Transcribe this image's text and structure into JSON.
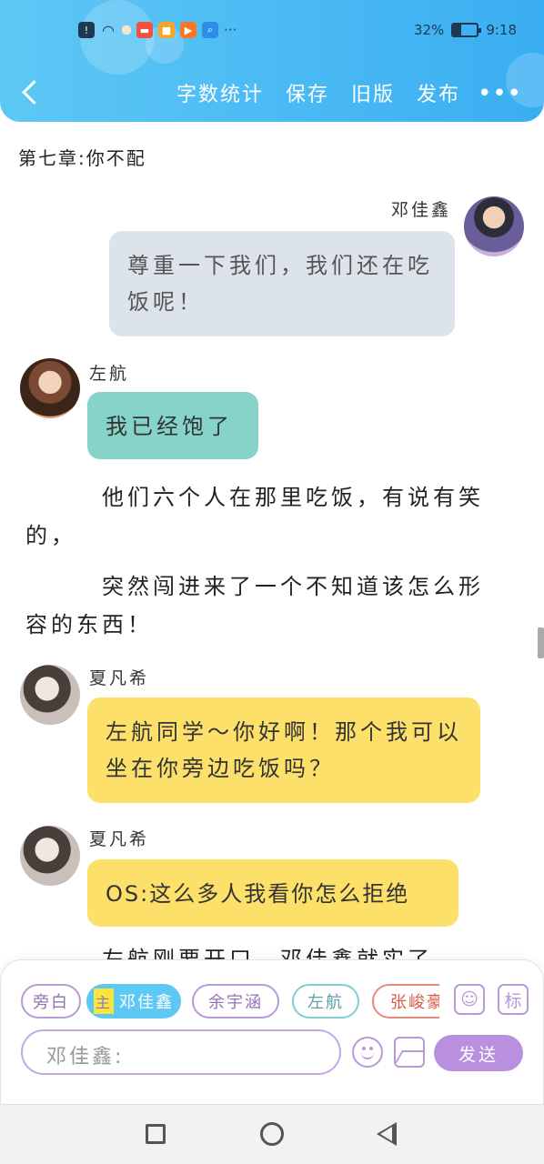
{
  "status_bar": {
    "battery_text": "32%",
    "battery_level": 0.32,
    "time": "9:18",
    "icons": [
      "alert-icon",
      "wifi-icon",
      "app-notification-icon",
      "taobao-icon",
      "app-icon",
      "video-icon",
      "search-icon",
      "more-dots-icon"
    ]
  },
  "header": {
    "actions": [
      "字数统计",
      "保存",
      "旧版",
      "发布"
    ],
    "more": "•••",
    "color": "#3aaef2"
  },
  "chapter_title": "第七章:你不配",
  "messages": [
    {
      "speaker": "邓佳鑫",
      "text": "尊重一下我们，我们还在吃饭呢！",
      "side": "right",
      "color": "#dde3ea"
    },
    {
      "speaker": "左航",
      "text": "我已经饱了",
      "side": "left",
      "color": "#85d3c9"
    },
    {
      "speaker": "夏凡希",
      "text": "左航同学～你好啊！那个我可以坐在你旁边吃饭吗？",
      "side": "left",
      "color": "#fde06a"
    },
    {
      "speaker": "夏凡希",
      "text": "OS:这么多人我看你怎么拒绝",
      "side": "left",
      "color": "#fde06a"
    }
  ],
  "narrations": [
    "他们六个人在那里吃饭，有说有笑的，",
    "突然闯进来了一个不知道该怎么形容的东西！",
    "左航刚要开口，邓佳鑫就实了"
  ],
  "composer": {
    "roles": [
      {
        "label": "旁白",
        "active": false
      },
      {
        "label": "邓佳鑫",
        "tag": "主",
        "active": true
      },
      {
        "label": "余宇涵",
        "active": false
      },
      {
        "label": "左航",
        "active": false
      },
      {
        "label": "张峻豪",
        "active": false
      }
    ],
    "mark_label": "标",
    "input_placeholder": "邓佳鑫:",
    "send_label": "发送",
    "accent": "#b990e0"
  }
}
